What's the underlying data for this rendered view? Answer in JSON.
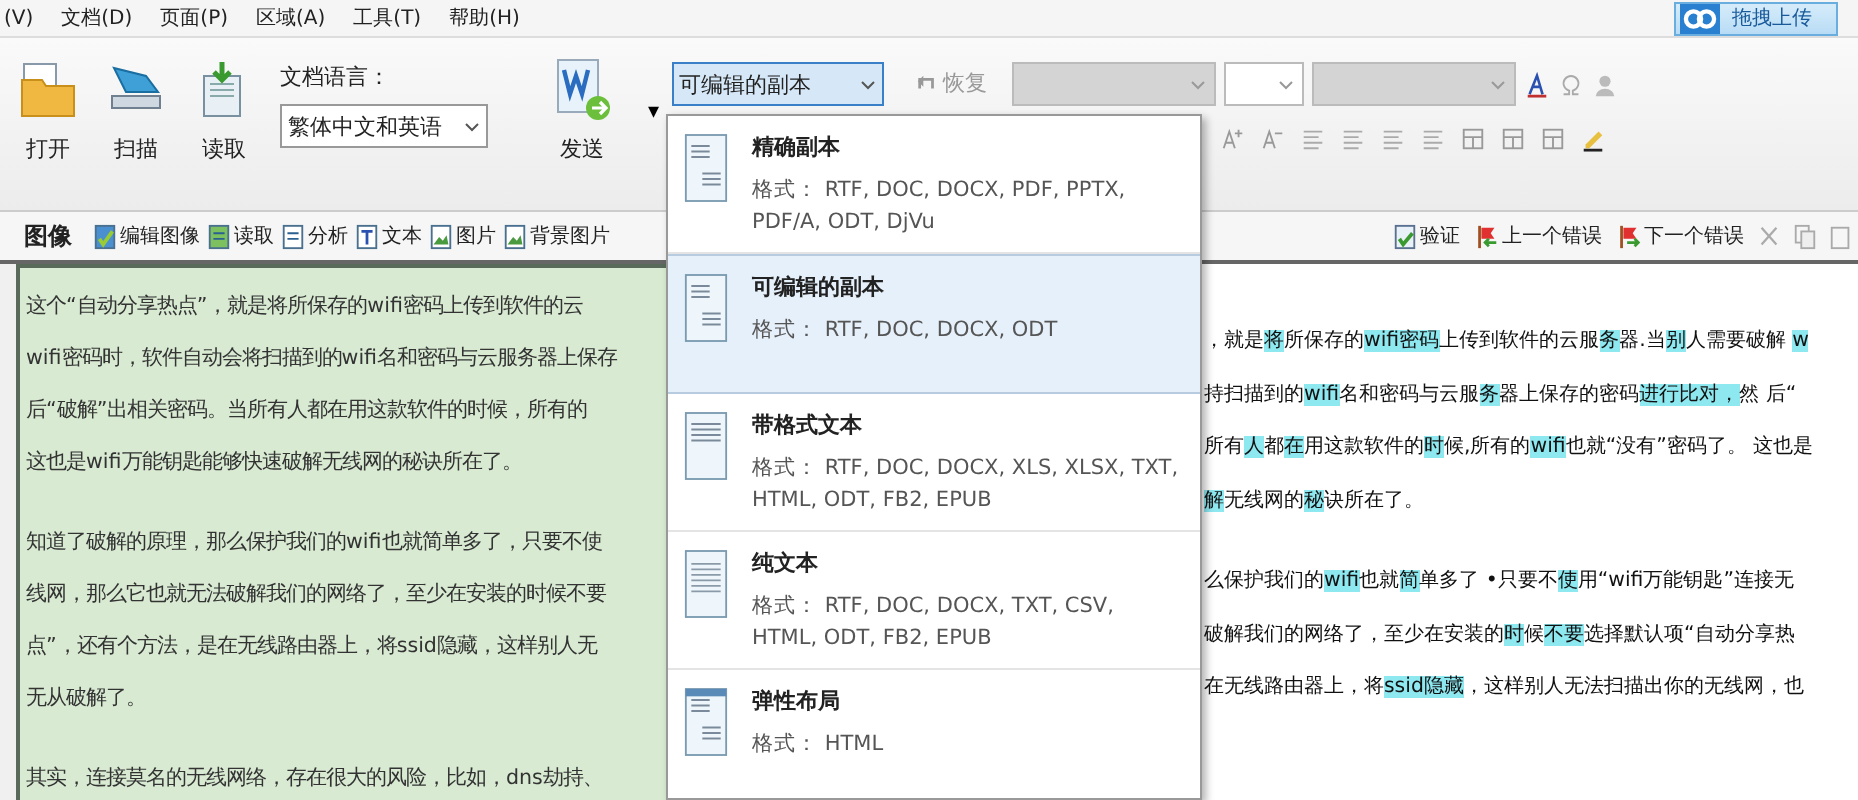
{
  "menu": [
    "(V)",
    "文档(D)",
    "页面(P)",
    "区域(A)",
    "工具(T)",
    "帮助(H)"
  ],
  "upload_button": "拖拽上传",
  "toolbar": {
    "buttons": [
      {
        "label": "打开",
        "kind": "open"
      },
      {
        "label": "扫描",
        "kind": "scan"
      },
      {
        "label": "读取",
        "kind": "read"
      }
    ],
    "language_label": "文档语言：",
    "language": "繁体中文和英语",
    "send": {
      "label": "发送",
      "arrow": "▾"
    },
    "save_format": "可编辑的副本",
    "restore": {
      "label": "恢复",
      "disabled": true
    }
  },
  "image_toolbar": {
    "title": "图像",
    "tools": [
      {
        "label": "编辑图像",
        "kind": "edit"
      },
      {
        "label": "读取",
        "kind": "read"
      },
      {
        "label": "分析",
        "kind": "analyze"
      },
      {
        "label": "文本",
        "kind": "text"
      },
      {
        "label": "图片",
        "kind": "picture"
      },
      {
        "label": "背景图片",
        "kind": "background"
      }
    ]
  },
  "text_toolbar": {
    "tools": [
      {
        "label": "验证",
        "kind": "verify"
      },
      {
        "label": "上一个错误",
        "kind": "prev"
      },
      {
        "label": "下一个错误",
        "kind": "next"
      }
    ]
  },
  "image_pane": {
    "paragraphs": [
      [
        "这个“自动分享热点”，就是将所保存的wifi密码上传到软件的云",
        "wifi密码时，软件自动会将扫描到的wifi名和密码与云服务器上保存",
        "后“破解”出相关密码。当所有人都在用这款软件的时候，所有的",
        "这也是wifi万能钥匙能够快速破解无线网的秘诀所在了。"
      ],
      [
        "知道了破解的原理，那么保护我们的wifi也就简单多了，只要不使",
        "线网，那么它也就无法破解我们的网络了，至少在安装的时候不要",
        "点”，还有个方法，是在无线路由器上，将ssid隐藏，这样别人无",
        "无从破解了。"
      ],
      [
        "其实，连接莫名的无线网络，存在很大的风险，比如，dns劫持、"
      ]
    ]
  },
  "text_pane": {
    "paragraphs": [
      [
        [
          {
            "text": "，就是",
            "flagged": false
          },
          {
            "text": "将",
            "flagged": true
          },
          {
            "text": "所保存的",
            "flagged": false
          },
          {
            "text": "wifi密码",
            "flagged": true
          },
          {
            "text": "上传到软件的云服",
            "flagged": false
          },
          {
            "text": "务",
            "flagged": true
          },
          {
            "text": "器.当",
            "flagged": false
          },
          {
            "text": "别",
            "flagged": true
          },
          {
            "text": "人需要破解 ",
            "flagged": false
          },
          {
            "text": "w",
            "flagged": true
          }
        ],
        [
          {
            "text": "持扫描到的",
            "flagged": false
          },
          {
            "text": "wifi",
            "flagged": true
          },
          {
            "text": "名和密码与云服",
            "flagged": false
          },
          {
            "text": "务",
            "flagged": true
          },
          {
            "text": "器上保存的密码",
            "flagged": false
          },
          {
            "text": "进行比对，",
            "flagged": true
          },
          {
            "text": "然 后“",
            "flagged": false
          }
        ],
        [
          {
            "text": "所有",
            "flagged": false
          },
          {
            "text": "人",
            "flagged": true
          },
          {
            "text": "都",
            "flagged": false
          },
          {
            "text": "在",
            "flagged": true
          },
          {
            "text": "用这款软件的",
            "flagged": false
          },
          {
            "text": "时",
            "flagged": true
          },
          {
            "text": "候,所有的",
            "flagged": false
          },
          {
            "text": "wifi",
            "flagged": true
          },
          {
            "text": "也就“没有”密码了。 这也是",
            "flagged": false
          }
        ],
        [
          {
            "text": "解",
            "flagged": true
          },
          {
            "text": "无线网的",
            "flagged": false
          },
          {
            "text": "秘",
            "flagged": true
          },
          {
            "text": "诀所在了。",
            "flagged": false
          }
        ]
      ],
      [
        [
          {
            "text": "么保护我们的",
            "flagged": false
          },
          {
            "text": "wifi",
            "flagged": true
          },
          {
            "text": "也就",
            "flagged": false
          },
          {
            "text": "简",
            "flagged": true
          },
          {
            "text": "单多了 •只要不",
            "flagged": false
          },
          {
            "text": "使",
            "flagged": true
          },
          {
            "text": "用“wifi万能钥匙”连接无",
            "flagged": false
          }
        ],
        [
          {
            "text": "破解我们的网络了，至少在安装的",
            "flagged": false
          },
          {
            "text": "时",
            "flagged": true
          },
          {
            "text": "候",
            "flagged": false
          },
          {
            "text": "不要",
            "flagged": true
          },
          {
            "text": "选择默认项“自动分享热",
            "flagged": false
          }
        ],
        [
          {
            "text": "在无线路由器上，将",
            "flagged": false
          },
          {
            "text": "ssid隐藏",
            "flagged": true
          },
          {
            "text": "，这样别人无法扫描出你的无线网，也",
            "flagged": false
          }
        ]
      ]
    ]
  },
  "format_menu": {
    "items": [
      {
        "title": "精确副本",
        "formats": "格式： RTF, DOC, DOCX, PDF, PPTX, PDF/A, ODT, DjVu",
        "selected": false,
        "kind": "exact"
      },
      {
        "title": "可编辑的副本",
        "formats": "格式： RTF, DOC, DOCX, ODT",
        "selected": true,
        "kind": "editable"
      },
      {
        "title": "带格式文本",
        "formats": "格式： RTF, DOC, DOCX, XLS, XLSX, TXT, HTML, ODT, FB2, EPUB",
        "selected": false,
        "kind": "formatted"
      },
      {
        "title": "纯文本",
        "formats": "格式： RTF, DOC, DOCX, TXT, CSV, HTML, ODT, FB2, EPUB",
        "selected": false,
        "kind": "plain"
      },
      {
        "title": "弹性布局",
        "formats": "格式： HTML",
        "selected": false,
        "kind": "flexible"
      }
    ]
  }
}
